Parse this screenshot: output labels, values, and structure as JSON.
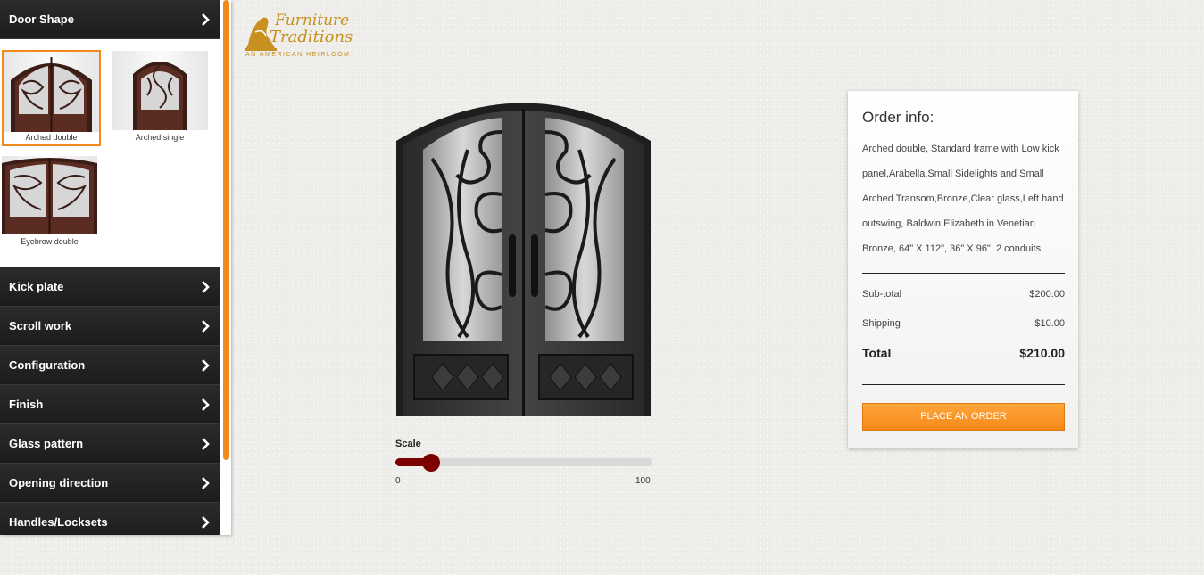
{
  "sidebar": {
    "door_shape_header": "Door Shape",
    "shapes": [
      {
        "label": "Arched double",
        "selected": true
      },
      {
        "label": "Arched single",
        "selected": false
      },
      {
        "label": "Eyebrow double",
        "selected": false
      }
    ],
    "sections": [
      {
        "label": "Kick plate"
      },
      {
        "label": "Scroll work"
      },
      {
        "label": "Configuration"
      },
      {
        "label": "Finish"
      },
      {
        "label": "Glass pattern"
      },
      {
        "label": "Opening direction"
      },
      {
        "label": "Handles/Locksets"
      }
    ]
  },
  "logo": {
    "line1": "Furniture",
    "line2": "Traditions",
    "tagline": "AN AMERICAN HEIRLOOM"
  },
  "scale": {
    "label": "Scale",
    "min": "0",
    "max": "100",
    "value": 14
  },
  "order": {
    "title": "Order info:",
    "description": "Arched double, Standard frame with Low kick panel,Arabella,Small Sidelights and Small Arched Transom,Bronze,Clear glass,Left hand outswing, Baldwin Elizabeth in Venetian Bronze, 64\" X 112\", 36\" X 96\", 2 conduits",
    "subtotal_label": "Sub-total",
    "subtotal_value": "$200.00",
    "shipping_label": "Shipping",
    "shipping_value": "$10.00",
    "total_label": "Total",
    "total_value": "$210.00",
    "button_label": "PLACE AN ORDER"
  },
  "colors": {
    "accent": "#f08a1c",
    "slider": "#7b0000",
    "header_bg": "#222222"
  }
}
